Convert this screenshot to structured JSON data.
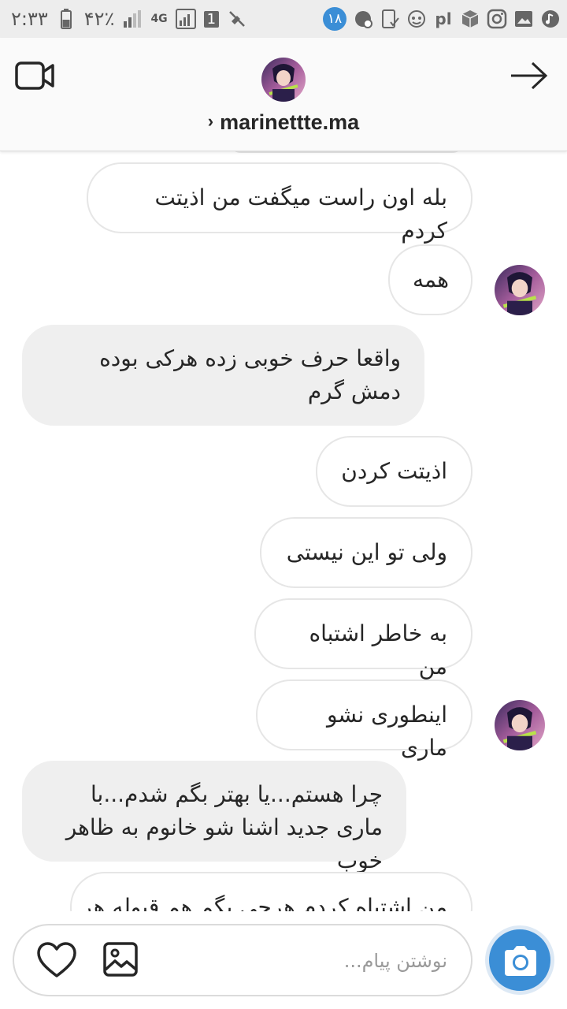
{
  "status_bar": {
    "time": "۲:۳۳",
    "battery": "۴۲٪",
    "network": "4G",
    "sim_slot": "1",
    "notification_badge": "۱۸"
  },
  "header": {
    "username": "marinettte.ma",
    "video_icon": "video-camera-icon",
    "forward_icon": "arrow-right-icon"
  },
  "messages": [
    {
      "side": "out",
      "text": "بله اون راست میگفت من اذیتت کردم"
    },
    {
      "side": "out",
      "text": "همه"
    },
    {
      "side": "in",
      "text": "واقعا حرف خوبی زده هرکی بوده دمش گرم"
    },
    {
      "side": "out",
      "text": "اذیتت کردن"
    },
    {
      "side": "out",
      "text": "ولی تو این نیستی"
    },
    {
      "side": "out",
      "text": "به خاطر اشتباه من"
    },
    {
      "side": "out",
      "text": "اینطوری نشو ماری"
    },
    {
      "side": "in",
      "text": "چرا هستم...یا بهتر بگم شدم...با ماری جدید اشنا شو خانوم به ظاهر خوب"
    },
    {
      "side": "out",
      "text": "من اشتباه کردم هرچی بگم هم قبوله هر"
    }
  ],
  "composer": {
    "placeholder": "نوشتن پیام...",
    "value": ""
  },
  "colors": {
    "accent": "#3b8ed6",
    "incoming_bubble": "#efefef",
    "outgoing_border": "#e6e6e6",
    "text": "#262626"
  }
}
